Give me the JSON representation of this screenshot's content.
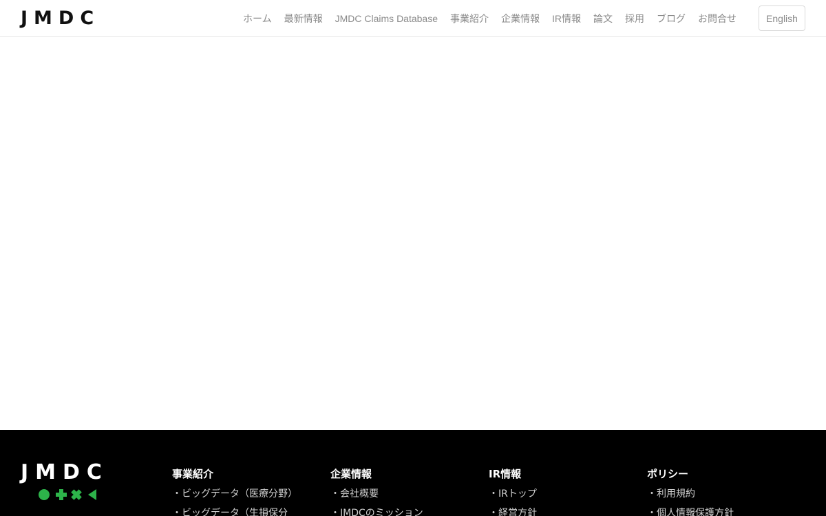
{
  "header": {
    "logo": "JMDC",
    "nav": [
      {
        "label": "ホーム"
      },
      {
        "label": "最新情報"
      },
      {
        "label": "JMDC Claims Database"
      },
      {
        "label": "事業紹介"
      },
      {
        "label": "企業情報"
      },
      {
        "label": "IR情報"
      },
      {
        "label": "論文"
      },
      {
        "label": "採用"
      },
      {
        "label": "ブログ"
      },
      {
        "label": "お問合せ"
      }
    ],
    "lang_label": "English"
  },
  "footer": {
    "logo": "JMDC",
    "colors": {
      "accent": "#2db34a"
    },
    "columns": [
      {
        "title": "事業紹介",
        "items": [
          "・ビッグデータ（医療分野）",
          "・ビッグデータ（生損保分"
        ]
      },
      {
        "title": "企業情報",
        "items": [
          "・会社概要",
          "・JMDCのミッション"
        ]
      },
      {
        "title": "IR情報",
        "items": [
          "・IRトップ",
          "・経営方針"
        ]
      },
      {
        "title": "ポリシー",
        "items": [
          "・利用規約",
          "・個人情報保護方針"
        ]
      }
    ]
  }
}
